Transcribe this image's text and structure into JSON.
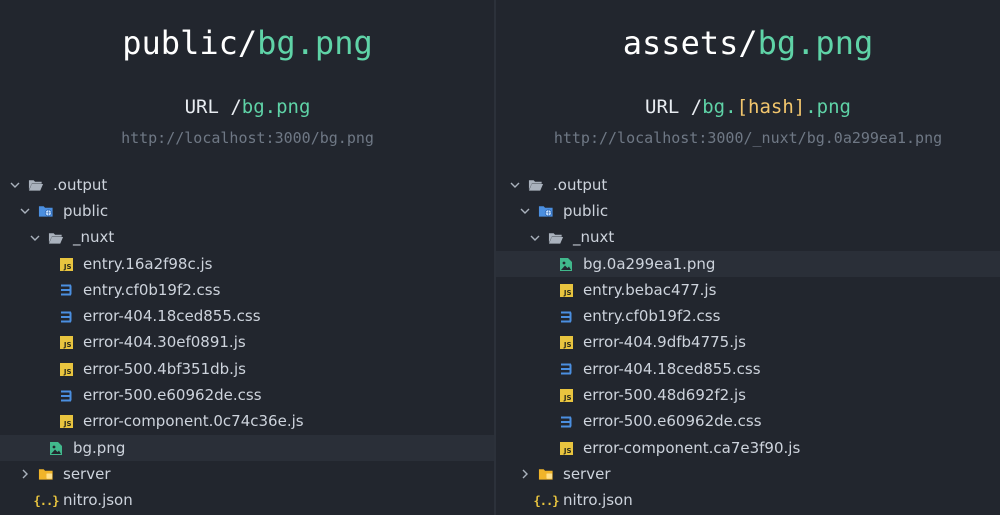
{
  "left": {
    "title_prefix": "public/",
    "title_file": "bg.png",
    "url_label": "URL ",
    "url_slash": "/",
    "url_path": "bg.png",
    "address": "http://localhost:3000/bg.png",
    "tree": {
      "output": ".output",
      "public": "public",
      "nuxt": "_nuxt",
      "files": [
        {
          "name": "entry.16a2f98c.js",
          "type": "js"
        },
        {
          "name": "entry.cf0b19f2.css",
          "type": "css"
        },
        {
          "name": "error-404.18ced855.css",
          "type": "css"
        },
        {
          "name": "error-404.30ef0891.js",
          "type": "js"
        },
        {
          "name": "error-500.4bf351db.js",
          "type": "js"
        },
        {
          "name": "error-500.e60962de.css",
          "type": "css"
        },
        {
          "name": "error-component.0c74c36e.js",
          "type": "js"
        }
      ],
      "bg": "bg.png",
      "server": "server",
      "nitro": "nitro.json"
    }
  },
  "right": {
    "title_prefix": "assets/",
    "title_file": "bg.png",
    "url_label": "URL ",
    "url_slash": "/",
    "url_path_a": "bg.",
    "url_hash": "[hash]",
    "url_path_b": ".png",
    "address": "http://localhost:3000/_nuxt/bg.0a299ea1.png",
    "tree": {
      "output": ".output",
      "public": "public",
      "nuxt": "_nuxt",
      "files": [
        {
          "name": "bg.0a299ea1.png",
          "type": "image"
        },
        {
          "name": "entry.bebac477.js",
          "type": "js"
        },
        {
          "name": "entry.cf0b19f2.css",
          "type": "css"
        },
        {
          "name": "error-404.9dfb4775.js",
          "type": "js"
        },
        {
          "name": "error-404.18ced855.css",
          "type": "css"
        },
        {
          "name": "error-500.48d692f2.js",
          "type": "js"
        },
        {
          "name": "error-500.e60962de.css",
          "type": "css"
        },
        {
          "name": "error-component.ca7e3f90.js",
          "type": "js"
        }
      ],
      "server": "server",
      "nitro": "nitro.json"
    }
  },
  "icons": {
    "chevron_down": "chevron-down-icon",
    "chevron_right": "chevron-right-icon",
    "folder_open": "folder-open-icon",
    "folder_public": "folder-public-icon",
    "folder_server": "folder-server-icon",
    "js_file": "js-file-icon",
    "css_file": "css-file-icon",
    "image_file": "image-file-icon",
    "json_file": "json-file-icon"
  },
  "colors": {
    "background": "#22262e",
    "accent_green": "#5fd3a7",
    "hash_yellow": "#f2c66d",
    "muted_url": "#6f7885",
    "js_yellow": "#e8c43f",
    "css_blue": "#4b8fe0",
    "image_teal": "#41b88c"
  }
}
